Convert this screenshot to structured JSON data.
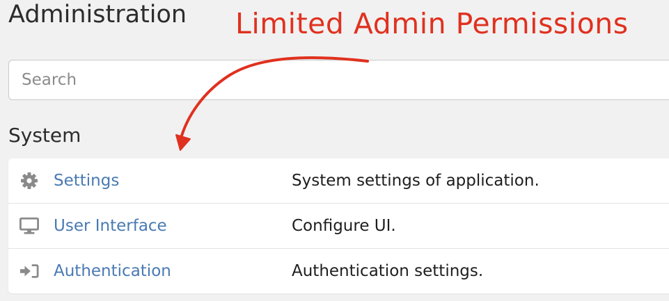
{
  "header": {
    "title": "Administration"
  },
  "annotation": {
    "text": "Limited Admin Permissions",
    "color": "#e0311f"
  },
  "search": {
    "placeholder": "Search",
    "value": ""
  },
  "section": {
    "title": "System"
  },
  "items": [
    {
      "label": "Settings",
      "description": "System settings of application.",
      "icon": "gear-icon"
    },
    {
      "label": "User Interface",
      "description": "Configure UI.",
      "icon": "monitor-icon"
    },
    {
      "label": "Authentication",
      "description": "Authentication settings.",
      "icon": "sign-in-icon"
    }
  ],
  "colors": {
    "link": "#4a7ab2",
    "icon": "#8a8a8a",
    "background": "#f1f1f1"
  }
}
